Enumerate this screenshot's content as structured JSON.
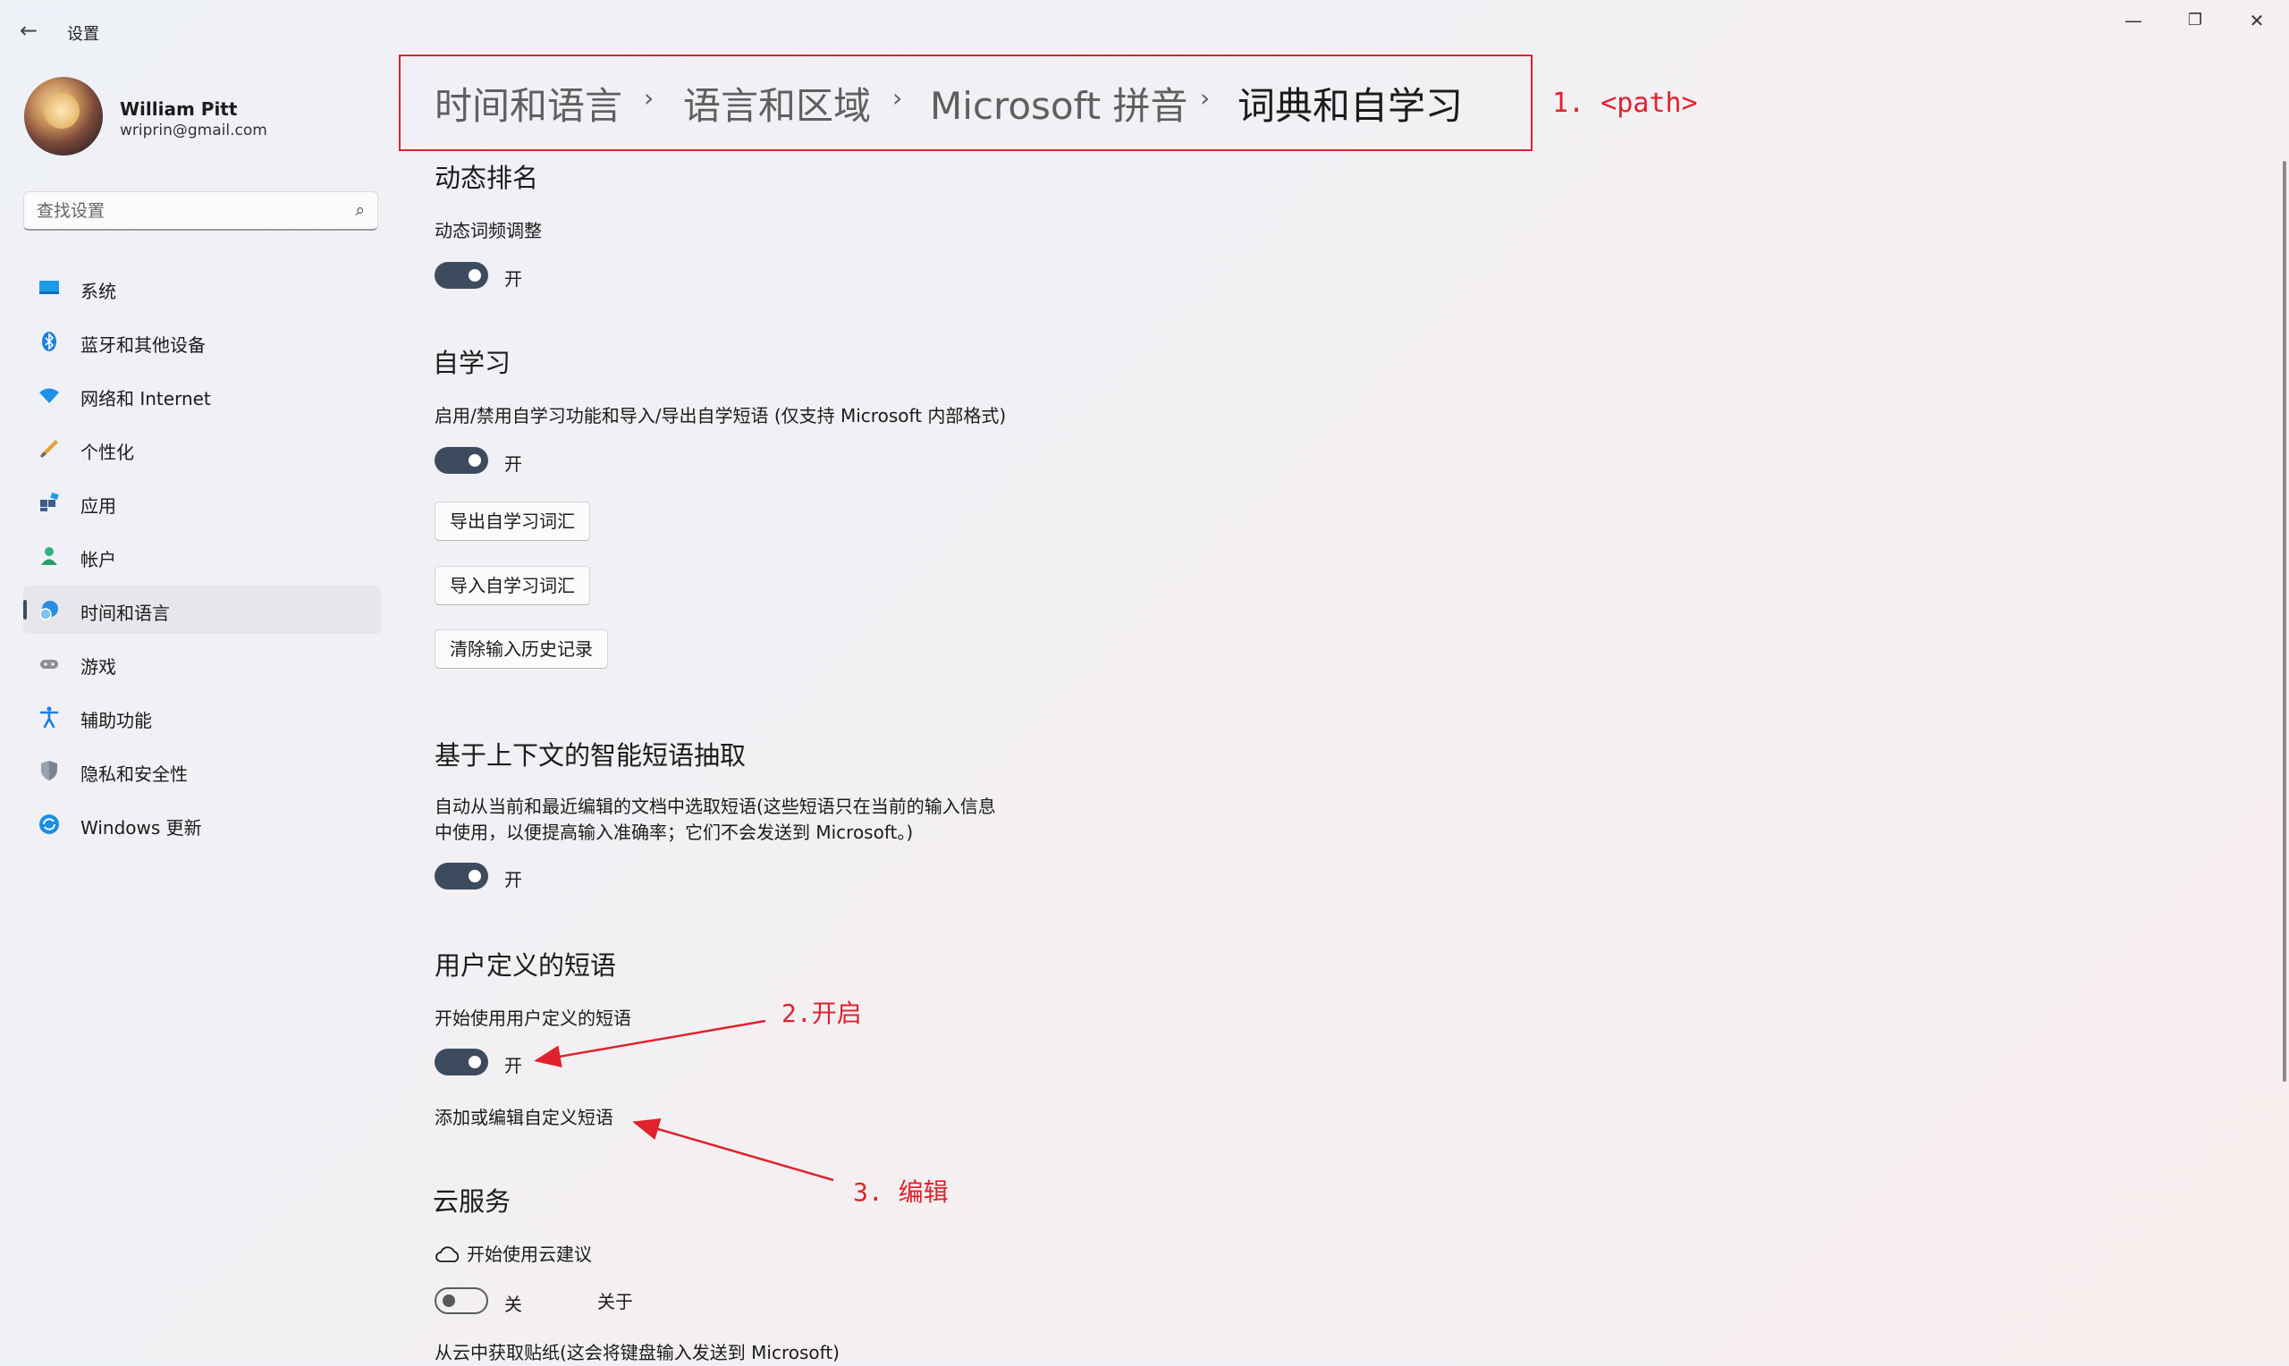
{
  "window": {
    "title": "设置",
    "controls": {
      "minimize": "—",
      "maximize": "❐",
      "close": "✕"
    }
  },
  "profile": {
    "name": "William Pitt",
    "email": "wriprin@gmail.com"
  },
  "search": {
    "placeholder": "查找设置"
  },
  "sidebar": {
    "items": [
      {
        "label": "系统",
        "icon": "monitor-icon"
      },
      {
        "label": "蓝牙和其他设备",
        "icon": "bluetooth-icon"
      },
      {
        "label": "网络和 Internet",
        "icon": "wifi-icon"
      },
      {
        "label": "个性化",
        "icon": "brush-icon"
      },
      {
        "label": "应用",
        "icon": "apps-icon"
      },
      {
        "label": "帐户",
        "icon": "account-icon"
      },
      {
        "label": "时间和语言",
        "icon": "globe-clock-icon",
        "active": true
      },
      {
        "label": "游戏",
        "icon": "gamepad-icon"
      },
      {
        "label": "辅助功能",
        "icon": "accessibility-icon"
      },
      {
        "label": "隐私和安全性",
        "icon": "shield-icon"
      },
      {
        "label": "Windows 更新",
        "icon": "update-icon"
      }
    ]
  },
  "breadcrumb": {
    "items": [
      "时间和语言",
      "语言和区域",
      "Microsoft 拼音",
      "词典和自学习"
    ],
    "separator": "›"
  },
  "annotations": {
    "path": "1. <path>",
    "enable": "2.开启",
    "edit": "3. 编辑",
    "color": "#e0222c"
  },
  "sections": {
    "dynamic": {
      "title": "动态排名",
      "setting_label": "动态词频调整",
      "toggle_state": "开",
      "toggle_on": true
    },
    "self_learning": {
      "title": "自学习",
      "setting_label": "启用/禁用自学习功能和导入/导出自学短语 (仅支持 Microsoft 内部格式)",
      "toggle_state": "开",
      "toggle_on": true,
      "buttons": {
        "export": "导出自学习词汇",
        "import": "导入自学习词汇",
        "clear": "清除输入历史记录"
      }
    },
    "context": {
      "title": "基于上下文的智能短语抽取",
      "desc_line1": "自动从当前和最近编辑的文档中选取短语(这些短语只在当前的输入信息",
      "desc_line2": "中使用，以便提高输入准确率；它们不会发送到 Microsoft。)",
      "toggle_state": "开",
      "toggle_on": true
    },
    "user_phrases": {
      "title": "用户定义的短语",
      "setting_label": "开始使用用户定义的短语",
      "toggle_state": "开",
      "toggle_on": true,
      "edit_link": "添加或编辑自定义短语"
    },
    "cloud": {
      "title": "云服务",
      "setting_label": "开始使用云建议",
      "toggle_state": "关",
      "toggle_on": false,
      "about": "关于",
      "stickers_label": "从云中获取贴纸(这会将键盘输入发送到 Microsoft)"
    }
  },
  "accent_color": "#3d4b5f"
}
